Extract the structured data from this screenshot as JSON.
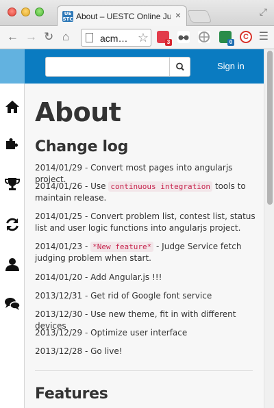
{
  "browser": {
    "tab_title": "About – UESTC Online Judge",
    "tab_favicon_text": "UE\nSTC",
    "url": "acm…",
    "extensions": [
      {
        "name": "ext-red",
        "color": "#e23b4a",
        "badge": "3",
        "badge_color": "#d8262f"
      },
      {
        "name": "ext-glasses",
        "color": "#555555",
        "badge": "",
        "badge_color": ""
      },
      {
        "name": "ext-globe",
        "color": "#9a9a9a",
        "badge": "",
        "badge_color": ""
      },
      {
        "name": "ext-html",
        "color": "#2a8c4a",
        "badge": "0",
        "badge_color": "#1f6fb2"
      },
      {
        "name": "ext-c",
        "color": "#d9342b",
        "badge": "",
        "badge_color": ""
      }
    ]
  },
  "navbar": {
    "search_placeholder": "",
    "signin_label": "Sign in"
  },
  "sidebar": {
    "items": [
      {
        "name": "home-icon"
      },
      {
        "name": "puzzle-icon"
      },
      {
        "name": "trophy-icon"
      },
      {
        "name": "refresh-icon"
      },
      {
        "name": "user-icon"
      },
      {
        "name": "comments-icon"
      }
    ]
  },
  "content": {
    "title": "About",
    "changelog_heading": "Change log",
    "features_heading": "Features",
    "log": [
      {
        "text": "2014/01/29 - Convert most pages into angularjs project."
      },
      {
        "prefix": "2014/01/26 - Use ",
        "code": "continuous integration",
        "suffix": " tools to maintain release."
      },
      {
        "text": "2014/01/25 - Convert problem list, contest list, status list and user logic functions into angularjs project."
      },
      {
        "prefix": "2014/01/23 - ",
        "code": "*New feature*",
        "suffix": " - Judge Service fetch judging problem when start."
      },
      {
        "text": "2014/01/20 - Add Angular.js !!!"
      },
      {
        "text": "2013/12/31 - Get rid of Google font service"
      },
      {
        "text": "2013/12/30 - Use new theme, fit in with different devices"
      },
      {
        "text": "2013/12/29 - Optimize user interface"
      },
      {
        "text": "2013/12/28 - Go live!"
      }
    ]
  },
  "colors": {
    "navbar": "#0a7bc1",
    "code_text": "#c7254e"
  }
}
